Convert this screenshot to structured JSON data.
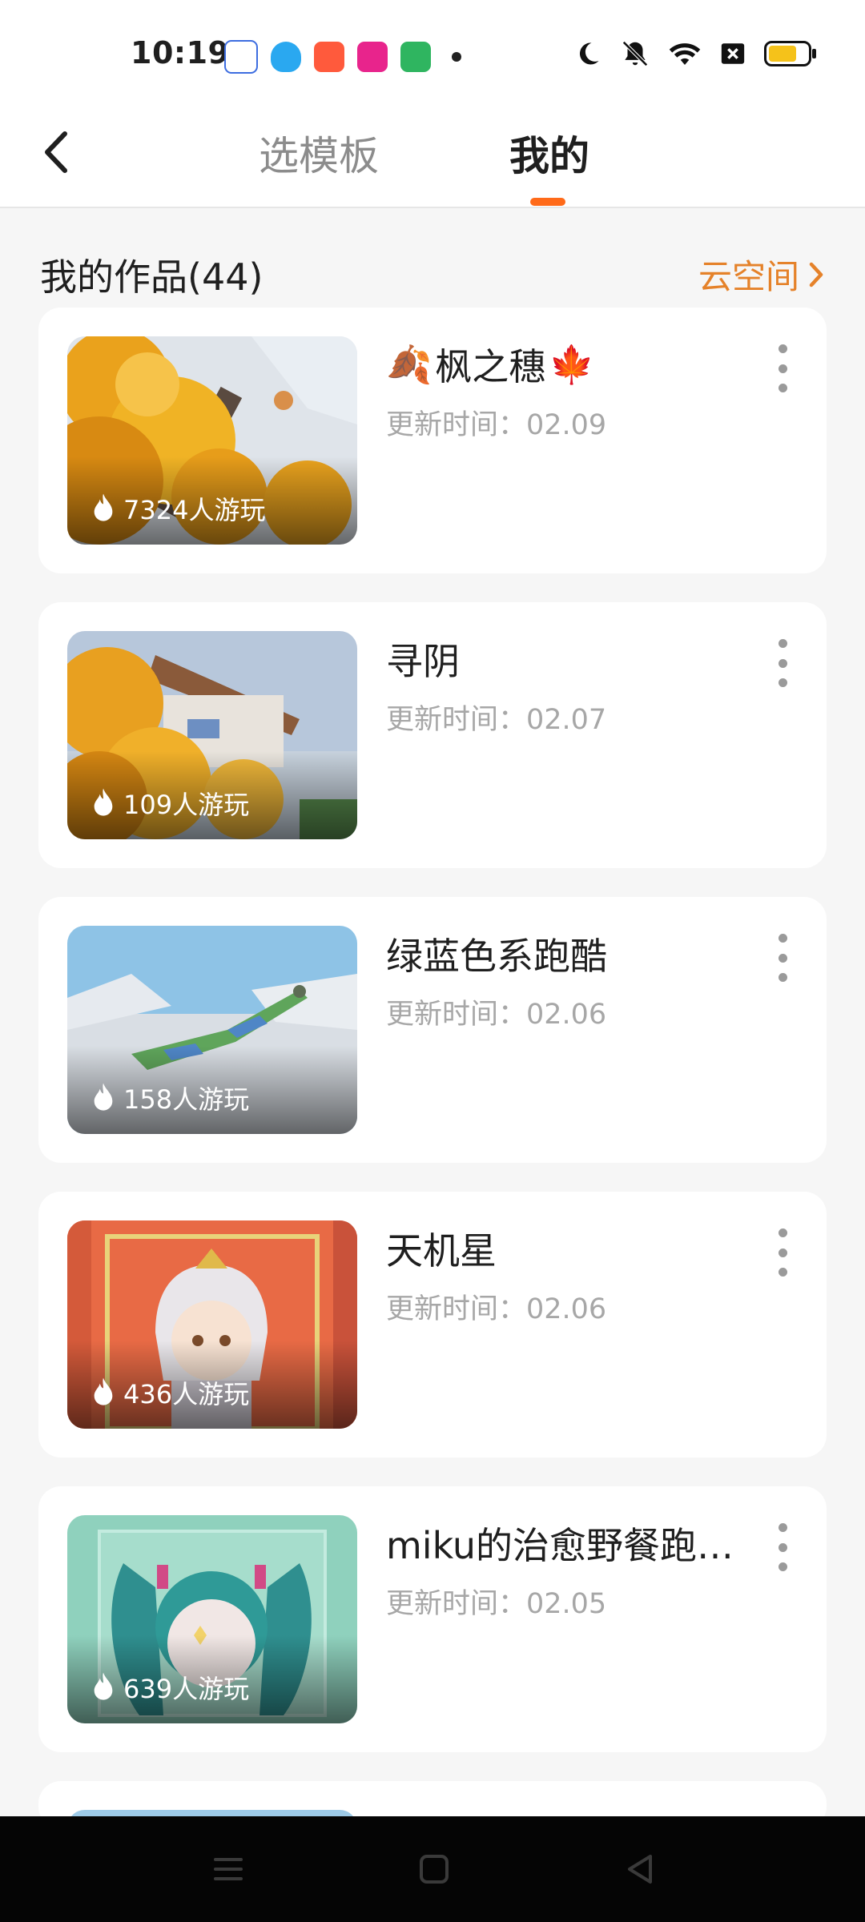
{
  "status_bar": {
    "time": "10:19",
    "app_icons": [
      "baidu-app-icon",
      "qq-app-icon",
      "kuaishou-app-icon",
      "video-app-icon",
      "shop-app-icon"
    ],
    "right_icons": [
      "moon-icon",
      "bell-off-icon",
      "wifi-icon",
      "sim-x-icon",
      "battery-icon"
    ]
  },
  "header": {
    "tabs": [
      {
        "label": "选模板",
        "active": false
      },
      {
        "label": "我的",
        "active": true
      }
    ]
  },
  "section": {
    "title": "我的作品(44)",
    "cloud_link": "云空间"
  },
  "works": [
    {
      "title": "枫之穗",
      "title_emoji_left": "🍂",
      "title_emoji_right": "🍁",
      "updated": "更新时间：02.09",
      "plays": "7324人游玩"
    },
    {
      "title": "寻阴",
      "updated": "更新时间：02.07",
      "plays": "109人游玩"
    },
    {
      "title": "绿蓝色系跑酷",
      "updated": "更新时间：02.06",
      "plays": "158人游玩"
    },
    {
      "title": "天机星",
      "updated": "更新时间：02.06",
      "plays": "436人游玩"
    },
    {
      "title": "miku的治愈野餐跑…",
      "updated": "更新时间：02.05",
      "plays": "639人游玩"
    }
  ],
  "colors": {
    "accent": "#ff6a19",
    "cloud_link": "#e5822a",
    "muted_text": "#a7a7a7"
  }
}
